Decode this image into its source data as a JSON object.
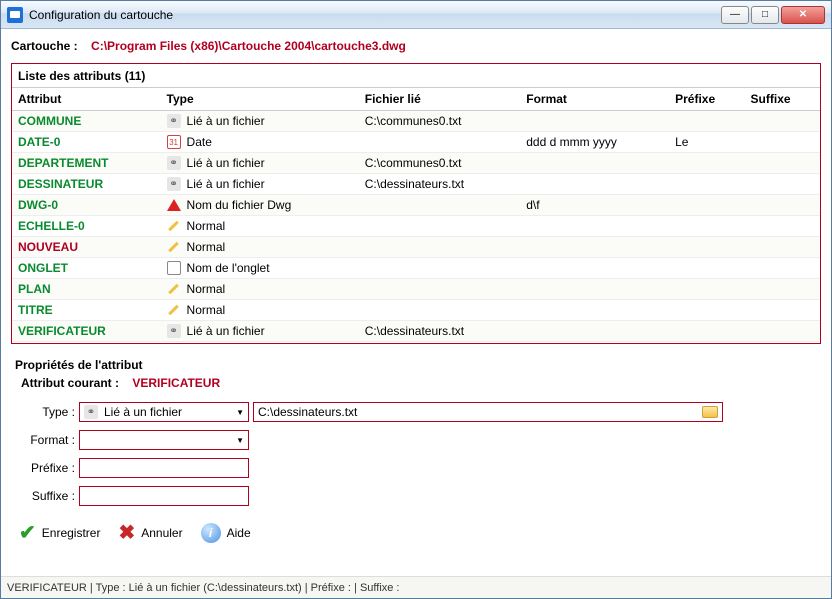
{
  "window": {
    "title": "Configuration du cartouche"
  },
  "header": {
    "label": "Cartouche :",
    "path": "C:\\Program Files (x86)\\Cartouche 2004\\cartouche3.dwg"
  },
  "panel": {
    "title": "Liste des attributs (11)",
    "columns": {
      "c0": "Attribut",
      "c1": "Type",
      "c2": "Fichier lié",
      "c3": "Format",
      "c4": "Préfixe",
      "c5": "Suffixe"
    },
    "rows": [
      {
        "name": "COMMUNE",
        "nameClass": "",
        "icon": "link",
        "type": "Lié à un fichier",
        "file": "C:\\communes0.txt",
        "fmt": "",
        "pre": "",
        "suf": ""
      },
      {
        "name": "DATE-0",
        "nameClass": "",
        "icon": "date",
        "type": "Date",
        "file": "",
        "fmt": "ddd d mmm yyyy",
        "pre": "Le",
        "suf": ""
      },
      {
        "name": "DEPARTEMENT",
        "nameClass": "",
        "icon": "link",
        "type": "Lié à un fichier",
        "file": "C:\\communes0.txt",
        "fmt": "",
        "pre": "",
        "suf": ""
      },
      {
        "name": "DESSINATEUR",
        "nameClass": "",
        "icon": "link",
        "type": "Lié à un fichier",
        "file": "C:\\dessinateurs.txt",
        "fmt": "",
        "pre": "",
        "suf": ""
      },
      {
        "name": "DWG-0",
        "nameClass": "",
        "icon": "dwg",
        "type": "Nom du fichier Dwg",
        "file": "",
        "fmt": "d\\f",
        "pre": "",
        "suf": ""
      },
      {
        "name": "ECHELLE-0",
        "nameClass": "",
        "icon": "pencil",
        "type": "Normal",
        "file": "",
        "fmt": "",
        "pre": "",
        "suf": ""
      },
      {
        "name": "NOUVEAU",
        "nameClass": "red",
        "icon": "pencil",
        "type": "Normal",
        "file": "",
        "fmt": "",
        "pre": "",
        "suf": ""
      },
      {
        "name": "ONGLET",
        "nameClass": "",
        "icon": "tab",
        "type": "Nom de l'onglet",
        "file": "",
        "fmt": "",
        "pre": "",
        "suf": ""
      },
      {
        "name": "PLAN",
        "nameClass": "",
        "icon": "pencil",
        "type": "Normal",
        "file": "",
        "fmt": "",
        "pre": "",
        "suf": ""
      },
      {
        "name": "TITRE",
        "nameClass": "",
        "icon": "pencil",
        "type": "Normal",
        "file": "",
        "fmt": "",
        "pre": "",
        "suf": ""
      },
      {
        "name": "VERIFICATEUR",
        "nameClass": "",
        "icon": "link",
        "type": "Lié à un fichier",
        "file": "C:\\dessinateurs.txt",
        "fmt": "",
        "pre": "",
        "suf": ""
      }
    ]
  },
  "props": {
    "section": "Propriétés de l'attribut",
    "current_label": "Attribut courant :",
    "current_value": "VERIFICATEUR",
    "labels": {
      "type": "Type :",
      "format": "Format :",
      "prefix": "Préfixe :",
      "suffix": "Suffixe :"
    },
    "type_value": "Lié à un fichier",
    "file_value": "C:\\dessinateurs.txt",
    "format_value": "",
    "prefix_value": "",
    "suffix_value": ""
  },
  "buttons": {
    "save": "Enregistrer",
    "cancel": "Annuler",
    "help": "Aide"
  },
  "status": "VERIFICATEUR | Type : Lié à un fichier (C:\\dessinateurs.txt) | Préfixe :  | Suffixe :"
}
